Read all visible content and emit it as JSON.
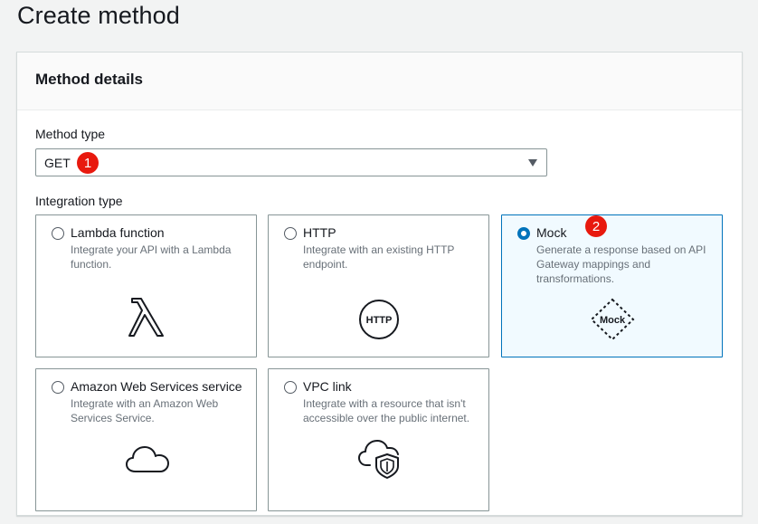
{
  "page": {
    "title": "Create method"
  },
  "panel": {
    "title": "Method details"
  },
  "method_type": {
    "label": "Method type",
    "value": "GET",
    "badge": "1"
  },
  "integration": {
    "label": "Integration type",
    "options": [
      {
        "title": "Lambda function",
        "description": "Integrate your API with a Lambda function.",
        "icon": "lambda-icon",
        "selected": false
      },
      {
        "title": "HTTP",
        "description": "Integrate with an existing HTTP endpoint.",
        "icon": "http-icon",
        "icon_text": "HTTP",
        "selected": false
      },
      {
        "title": "Mock",
        "description": "Generate a response based on API Gateway mappings and transformations.",
        "icon": "mock-icon",
        "icon_text": "Mock",
        "selected": true,
        "badge": "2"
      },
      {
        "title": "Amazon Web Services service",
        "description": "Integrate with an Amazon Web Services Service.",
        "icon": "cloud-icon",
        "selected": false
      },
      {
        "title": "VPC link",
        "description": "Integrate with a resource that isn't accessible over the public internet.",
        "icon": "cloud-shield-icon",
        "selected": false
      }
    ]
  },
  "colors": {
    "accent": "#0073bb",
    "badge": "#e8190e",
    "selected_bg": "#f1faff"
  }
}
